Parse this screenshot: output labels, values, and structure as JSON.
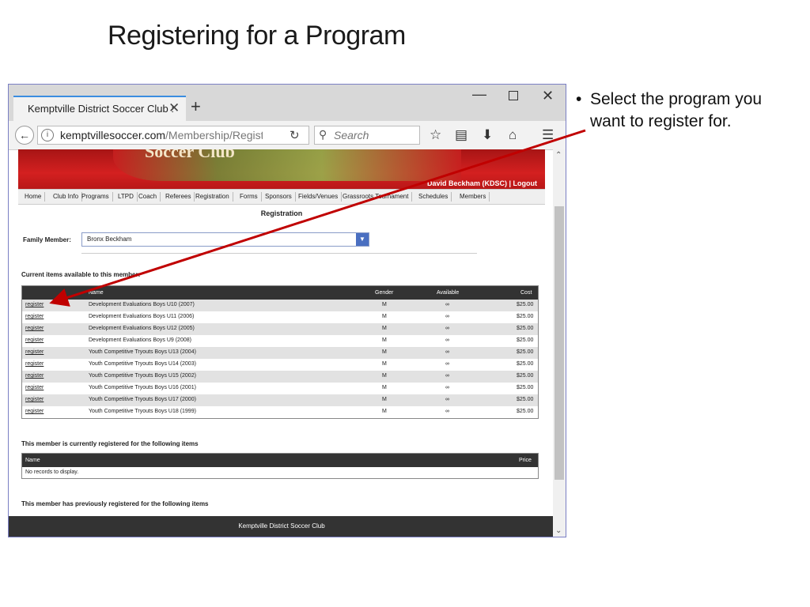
{
  "slide": {
    "title": "Registering for a Program",
    "bullet": "Select the program you want to register for."
  },
  "browser": {
    "tab_title": "Kemptville District Soccer Club :",
    "tab_close": "✕",
    "new_tab": "+",
    "url_domain": "kemptvillesoccer.com",
    "url_path": "/Membership/Registe",
    "search_placeholder": "Search"
  },
  "site": {
    "banner_text": "Soccer Club",
    "user_bar": "David Beckham (KDSC) | Logout",
    "menu": [
      "Home",
      "Club Info",
      "Programs",
      "LTPD",
      "Coach",
      "Referees",
      "Registration",
      "Forms",
      "Sponsors",
      "Fields/Venues",
      "Grassroots Tournament",
      "Schedules",
      "Members"
    ],
    "page_heading": "Registration",
    "family_label": "Family Member:",
    "family_value": "Bronx Beckham",
    "current_title": "Current items available to this member:",
    "current_headers": {
      "name": "Name",
      "gender": "Gender",
      "available": "Available",
      "cost": "Cost"
    },
    "items": [
      {
        "link": "register",
        "name": "Development Evaluations Boys U10 (2007)",
        "gender": "M",
        "available": "∞",
        "cost": "$25.00"
      },
      {
        "link": "register",
        "name": "Development Evaluations Boys U11 (2006)",
        "gender": "M",
        "available": "∞",
        "cost": "$25.00"
      },
      {
        "link": "register",
        "name": "Development Evaluations Boys U12 (2005)",
        "gender": "M",
        "available": "∞",
        "cost": "$25.00"
      },
      {
        "link": "register",
        "name": "Development Evaluations Boys U9 (2008)",
        "gender": "M",
        "available": "∞",
        "cost": "$25.00"
      },
      {
        "link": "register",
        "name": "Youth Competitive Tryouts Boys U13 (2004)",
        "gender": "M",
        "available": "∞",
        "cost": "$25.00"
      },
      {
        "link": "register",
        "name": "Youth Competitive Tryouts Boys U14 (2003)",
        "gender": "M",
        "available": "∞",
        "cost": "$25.00"
      },
      {
        "link": "register",
        "name": "Youth Competitive Tryouts Boys U15 (2002)",
        "gender": "M",
        "available": "∞",
        "cost": "$25.00"
      },
      {
        "link": "register",
        "name": "Youth Competitive Tryouts Boys U16 (2001)",
        "gender": "M",
        "available": "∞",
        "cost": "$25.00"
      },
      {
        "link": "register",
        "name": "Youth Competitive Tryouts Boys U17 (2000)",
        "gender": "M",
        "available": "∞",
        "cost": "$25.00"
      },
      {
        "link": "register",
        "name": "Youth Competitive Tryouts Boys U18 (1999)",
        "gender": "M",
        "available": "∞",
        "cost": "$25.00"
      }
    ],
    "registered_title": "This member is currently registered for the following items",
    "registered_headers": {
      "name": "Name",
      "price": "Price"
    },
    "no_records": "No records to display.",
    "previous_title": "This member has previously registered for the following items",
    "footer": "Kemptville District Soccer Club"
  },
  "colors": {
    "annotation_arrow": "#c00000",
    "banner_red": "#d42020",
    "grid_header": "#333333",
    "select_arrow": "#4a6fc1"
  }
}
